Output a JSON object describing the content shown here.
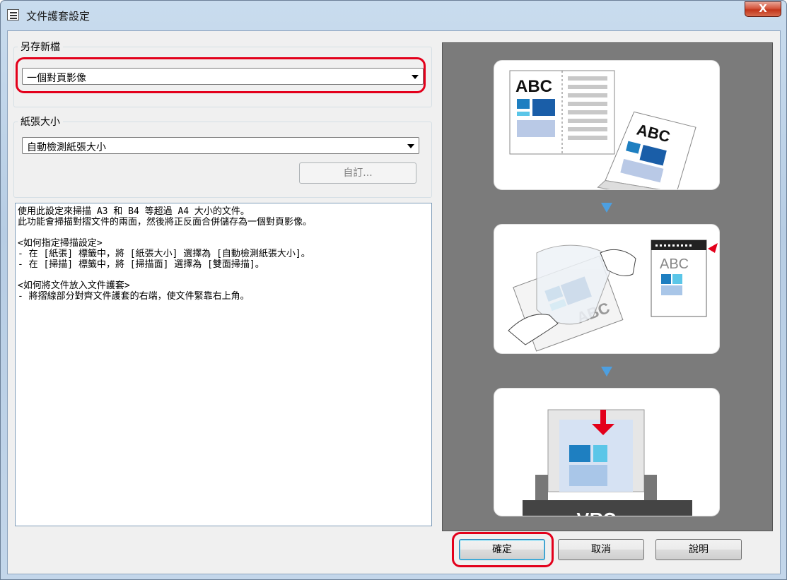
{
  "window": {
    "title": "文件護套設定",
    "close_label": "X"
  },
  "save_as": {
    "group_label": "另存新檔",
    "selected": "一個對頁影像"
  },
  "paper_size": {
    "group_label": "紙張大小",
    "selected": "自動檢測紙張大小",
    "custom_button": "自訂..."
  },
  "description": "使用此設定來掃描 A3 和 B4 等超過 A4 大小的文件。\n此功能會掃描對摺文件的兩面，然後將正反面合併儲存為一個對頁影像。\n\n<如何指定掃描設定>\n- 在 [紙張] 標籤中，將 [紙張大小] 選擇為 [自動檢測紙張大小]。\n- 在 [掃描] 標籤中，將 [掃描面] 選擇為 [雙面掃描]。\n\n<如何將文件放入文件護套>\n- 將摺線部分對齊文件護套的右端，使文件緊靠右上角。",
  "illustration": {
    "text_abc": "ABC",
    "text_abc_mirrored": "ABC"
  },
  "buttons": {
    "ok": "確定",
    "cancel": "取消",
    "help": "說明"
  },
  "colors": {
    "highlight": "#e3001b",
    "accent_blue": "#1e7fc1",
    "light_blue": "#5bc6e8",
    "pale_blue": "#a9c6e8",
    "preview_bg": "#7b7b7b"
  }
}
